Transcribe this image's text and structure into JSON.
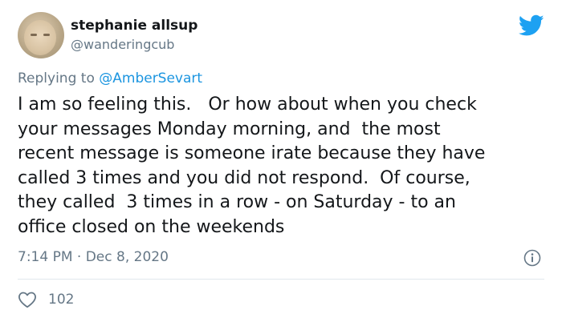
{
  "author": {
    "name": "stephanie allsup",
    "handle": "@wanderingcub"
  },
  "reply": {
    "prefix": "Replying to ",
    "mention": "@AmberSevart"
  },
  "tweet": {
    "lines": [
      "I am so feeling this.   Or how about when you check",
      "your messages Monday morning, and  the most",
      "recent message is someone irate because they have",
      "called 3 times and you did not respond.  Of course,",
      "they called  3 times in a row - on Saturday - to an",
      "office closed on the weekends"
    ]
  },
  "meta": {
    "timestamp": "7:14 PM · Dec 8, 2020"
  },
  "engagement": {
    "like_count": "102"
  },
  "icons": {
    "logo": "twitter-bird-icon",
    "info": "info-icon",
    "like": "heart-icon"
  },
  "colors": {
    "brand": "#1da1f2",
    "link": "#1b95e0",
    "muted": "#657786",
    "text": "#14171a"
  }
}
